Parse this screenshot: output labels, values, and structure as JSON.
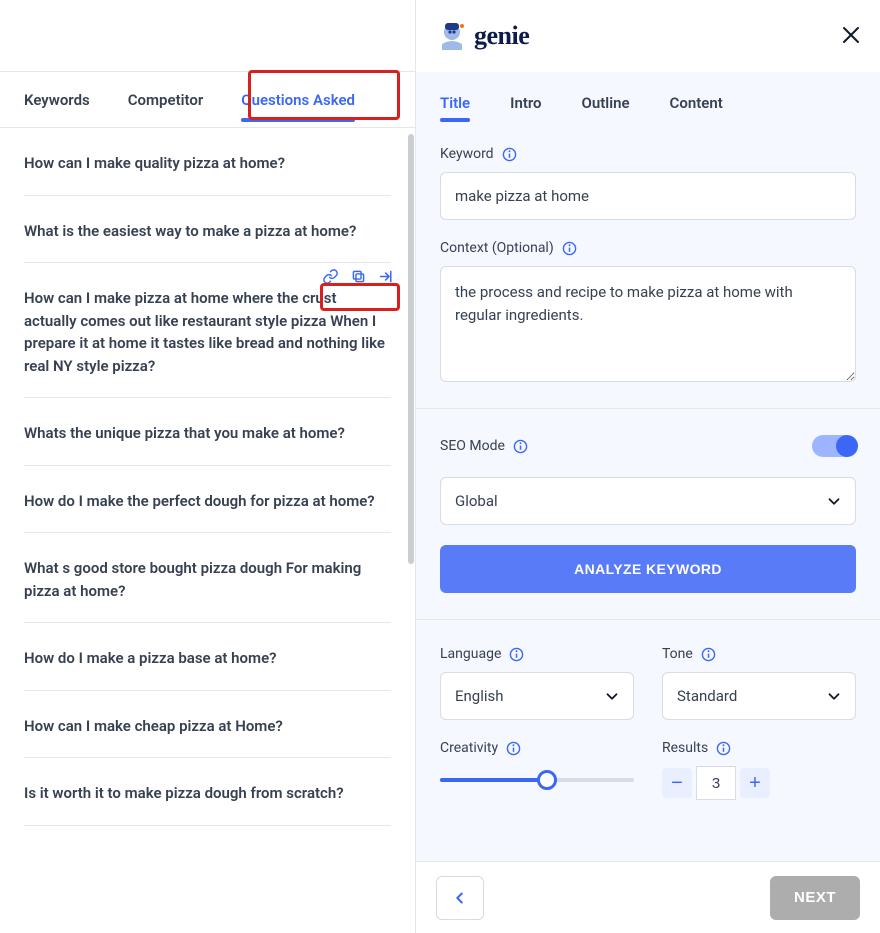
{
  "brand": {
    "name": "genie"
  },
  "leftTabs": [
    {
      "label": "Keywords"
    },
    {
      "label": "Competitor"
    },
    {
      "label": "Questions Asked"
    }
  ],
  "activeLeftTabIndex": 2,
  "questions": [
    {
      "text": "How can I make quality pizza at home?"
    },
    {
      "text": "What is the easiest way to make a pizza at home?"
    },
    {
      "text": "How can I make pizza at home where the crust actually comes out like restaurant style pizza When I prepare it at home it tastes like bread and nothing like real NY style pizza?",
      "showActions": true
    },
    {
      "text": "Whats the unique pizza that you make at home?"
    },
    {
      "text": "How do I make the perfect dough for pizza at home?"
    },
    {
      "text": "What s good store bought pizza dough For making pizza at home?"
    },
    {
      "text": "How do I make a pizza base at home?"
    },
    {
      "text": "How can I make cheap pizza at Home?"
    },
    {
      "text": "Is it worth it to make pizza dough from scratch?"
    }
  ],
  "rightTabs": [
    {
      "label": "Title"
    },
    {
      "label": "Intro"
    },
    {
      "label": "Outline"
    },
    {
      "label": "Content"
    }
  ],
  "activeRightTabIndex": 0,
  "form": {
    "keywordLabel": "Keyword",
    "keywordValue": "make pizza at home",
    "contextLabel": "Context (Optional)",
    "contextValue": "the process and recipe to make pizza at home with regular ingredients.",
    "seoModeLabel": "SEO Mode",
    "seoModeOn": true,
    "regionValue": "Global",
    "analyzeLabel": "ANALYZE KEYWORD",
    "languageLabel": "Language",
    "languageValue": "English",
    "toneLabel": "Tone",
    "toneValue": "Standard",
    "creativityLabel": "Creativity",
    "creativityPercent": 55,
    "resultsLabel": "Results",
    "resultsValue": "3"
  },
  "footer": {
    "nextLabel": "NEXT"
  }
}
